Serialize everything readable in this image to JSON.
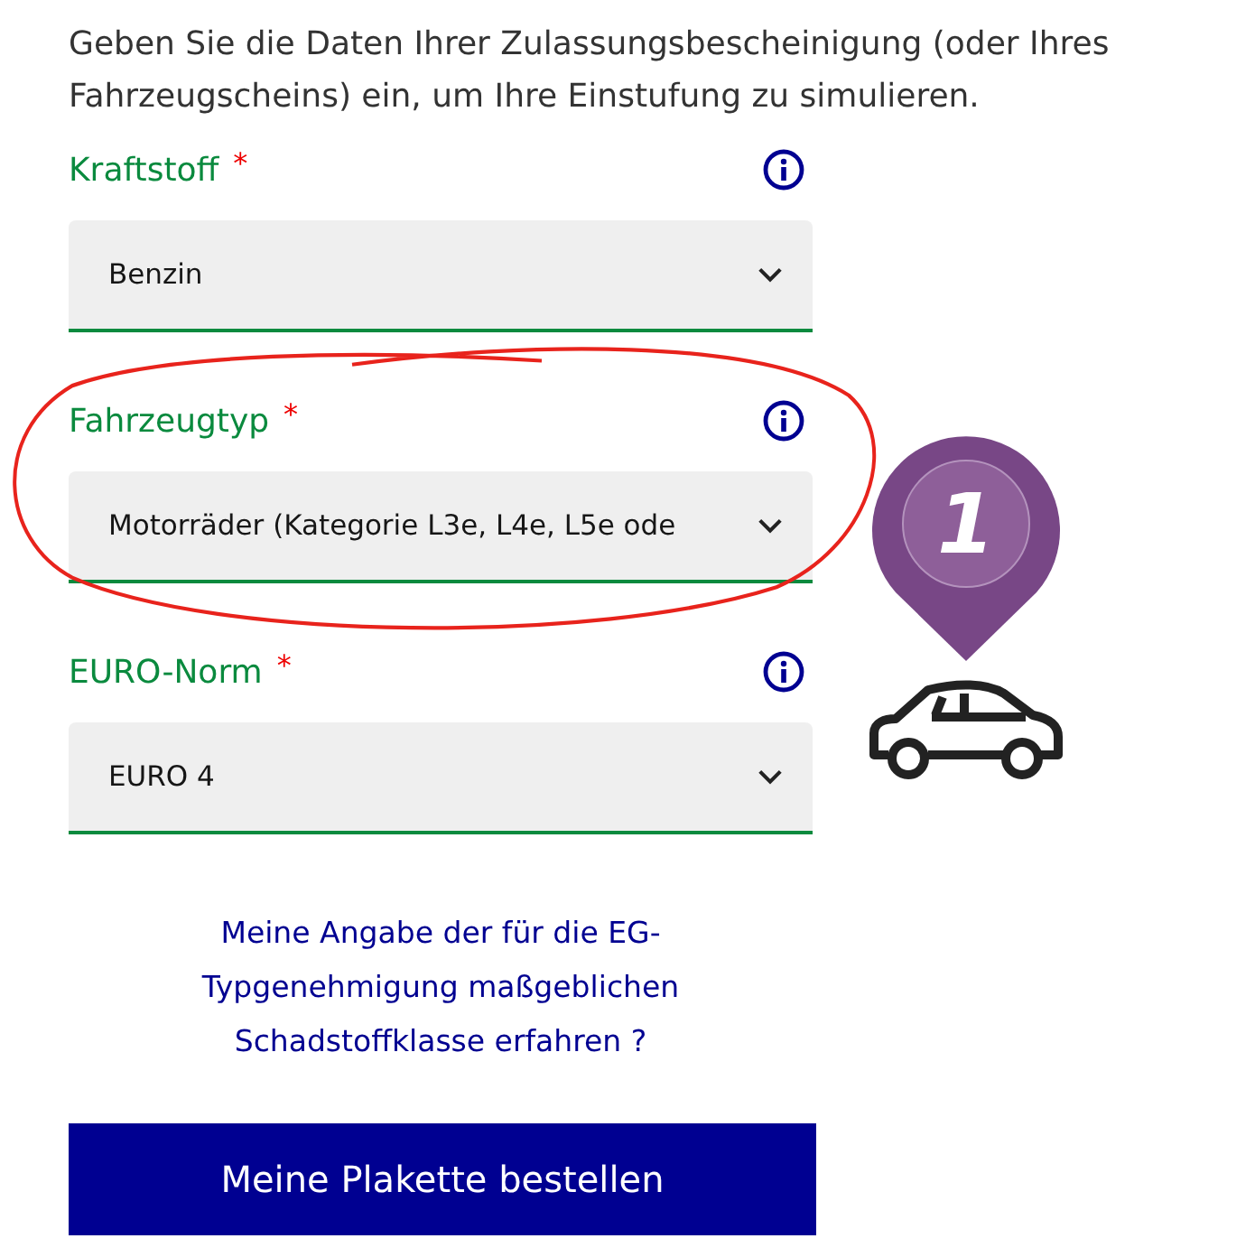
{
  "intro": "Geben Sie die Daten Ihrer Zulassungsbescheinigung (oder Ihres Fahrzeugscheins) ein, um Ihre Einstufung zu simulieren.",
  "fields": [
    {
      "label": "Kraftstoff",
      "required_mark": "*",
      "value": "Benzin",
      "annotated": false
    },
    {
      "label": "Fahrzeugtyp",
      "required_mark": "*",
      "value": "Motorräder (Kategorie L3e, L4e, L5e ode",
      "annotated": true
    },
    {
      "label": "EURO-Norm",
      "required_mark": "*",
      "value": "EURO 4",
      "annotated": false
    }
  ],
  "link": "Meine Angabe der für die EG-Typgenehmigung maßgeblichen Schadstoffklasse erfahren ?",
  "button": "Meine Plakette bestellen",
  "step_badge": "1"
}
